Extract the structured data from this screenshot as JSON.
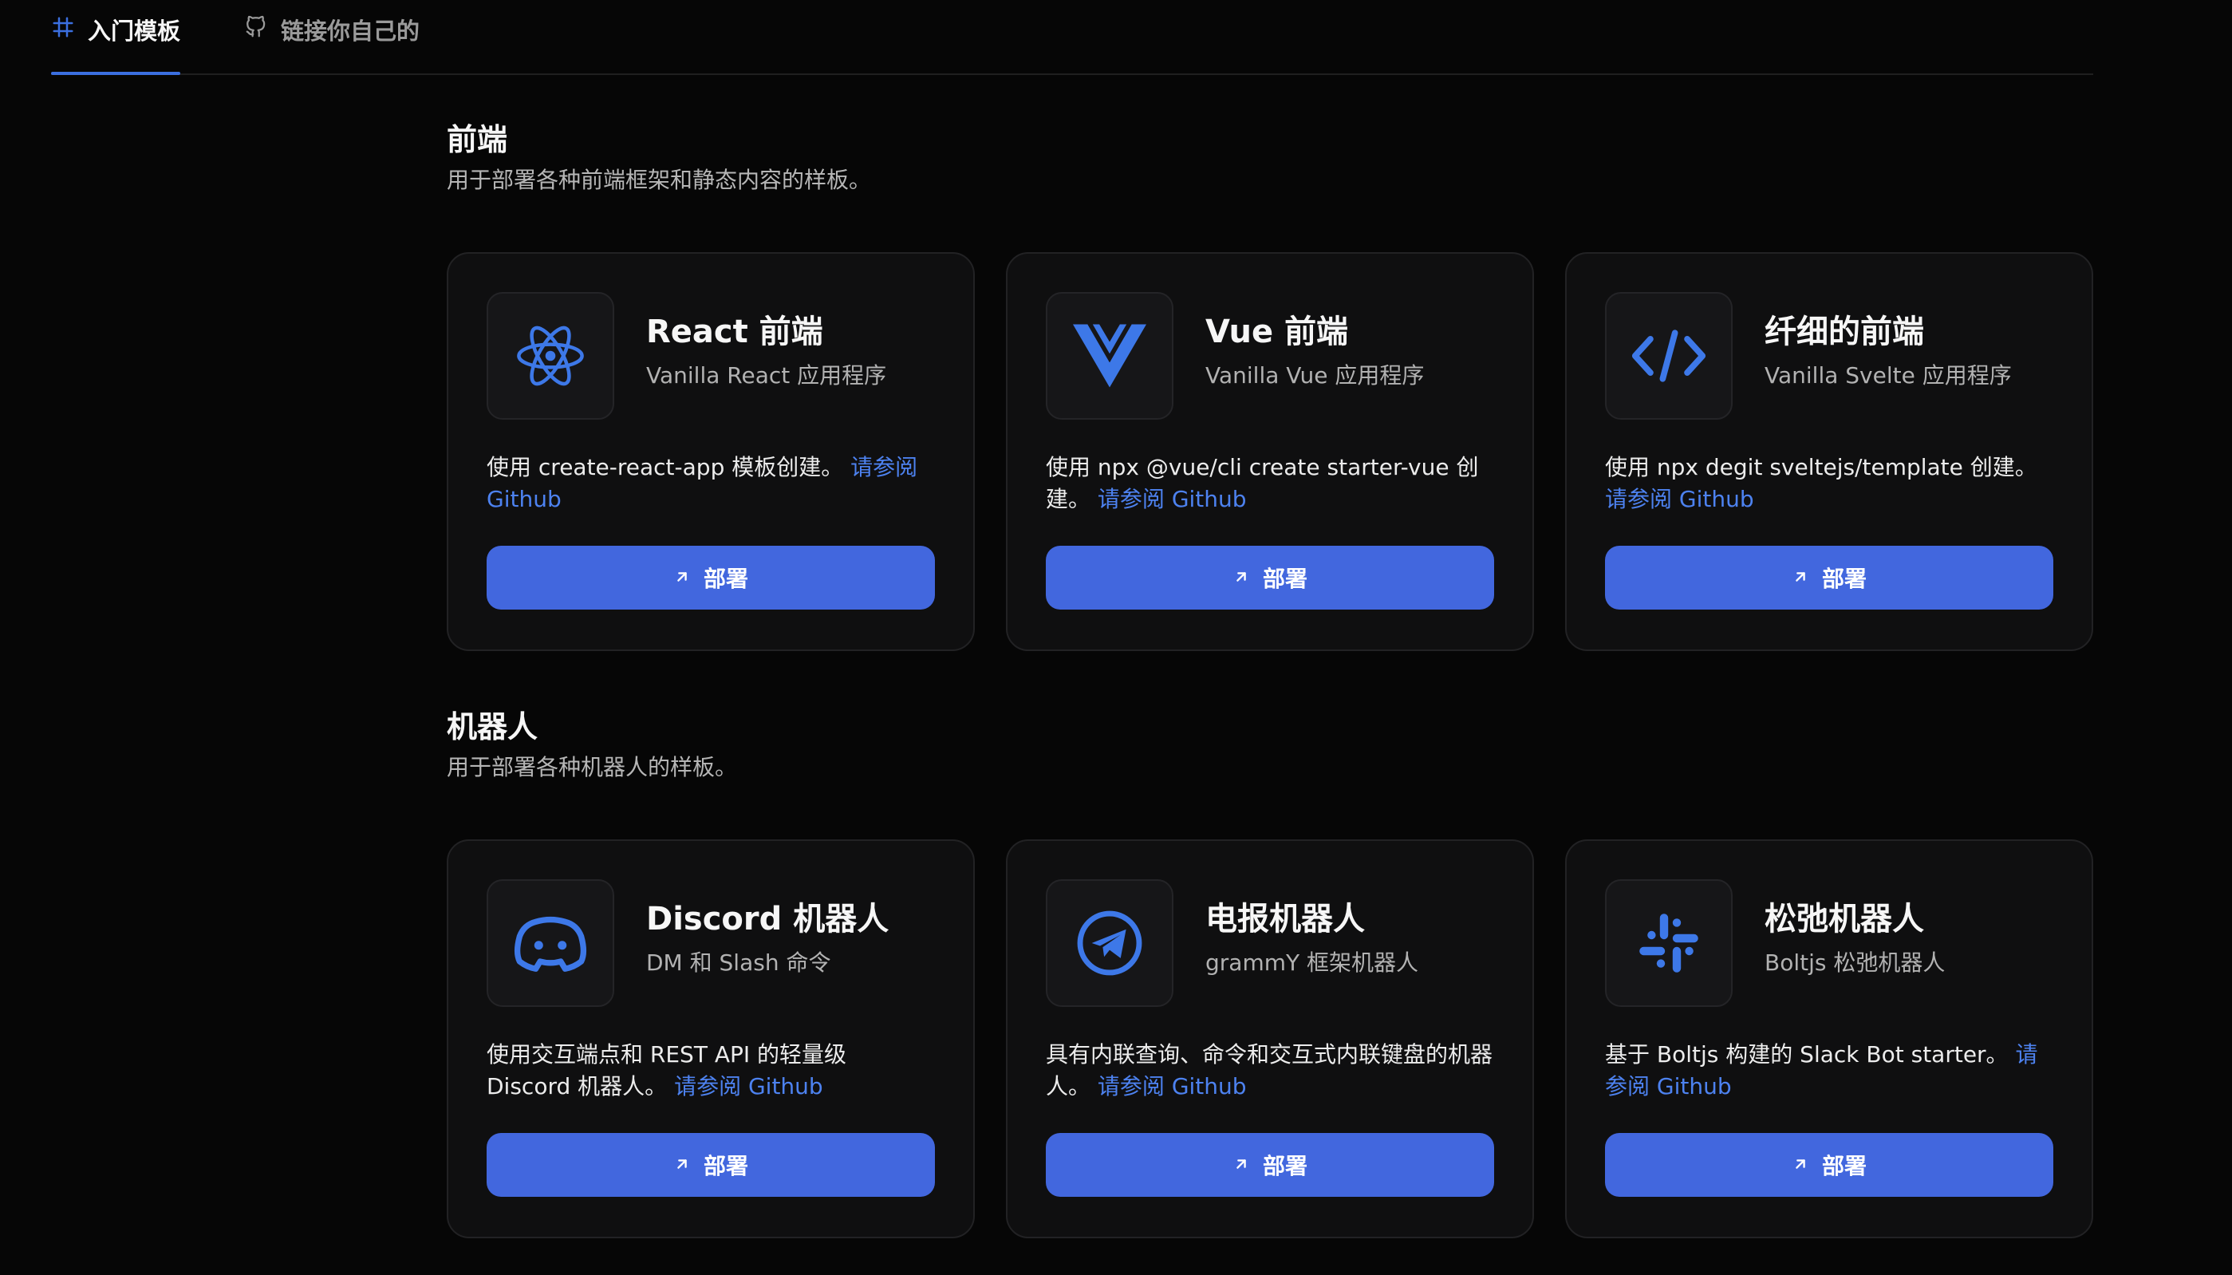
{
  "tabs": [
    {
      "label": "入门模板",
      "icon": "template-icon",
      "active": true
    },
    {
      "label": "链接你自己的",
      "icon": "github-icon",
      "active": false
    }
  ],
  "sections": [
    {
      "title": "前端",
      "description": "用于部署各种前端框架和静态内容的样板。",
      "cards": [
        {
          "title": "React 前端",
          "subtitle": "Vanilla React 应用程序",
          "icon": "react-icon",
          "desc": "使用 create-react-app 模板创建。",
          "link": "请参阅 Github",
          "button": "部署"
        },
        {
          "title": "Vue 前端",
          "subtitle": "Vanilla Vue 应用程序",
          "icon": "vue-icon",
          "desc": "使用 npx @vue/cli create starter-vue 创建。",
          "link": "请参阅 Github",
          "button": "部署"
        },
        {
          "title": "纤细的前端",
          "subtitle": "Vanilla Svelte 应用程序",
          "icon": "code-icon",
          "desc": "使用 npx degit sveltejs/template 创建。",
          "link": "请参阅 Github",
          "button": "部署"
        }
      ]
    },
    {
      "title": "机器人",
      "description": "用于部署各种机器人的样板。",
      "cards": [
        {
          "title": "Discord 机器人",
          "subtitle": "DM 和 Slash 命令",
          "icon": "discord-icon",
          "desc": "使用交互端点和 REST API 的轻量级 Discord 机器人。",
          "link": "请参阅 Github",
          "button": "部署"
        },
        {
          "title": "电报机器人",
          "subtitle": "grammY 框架机器人",
          "icon": "telegram-icon",
          "desc": "具有内联查询、命令和交互式内联键盘的机器人。",
          "link": "请参阅 Github",
          "button": "部署"
        },
        {
          "title": "松弛机器人",
          "subtitle": "Boltjs 松弛机器人",
          "icon": "slack-icon",
          "desc": "基于 Boltjs 构建的 Slack Bot starter。",
          "link": "请参阅 Github",
          "button": "部署"
        }
      ]
    }
  ],
  "colors": {
    "accent": "#4267de",
    "link": "#4d82f0",
    "background": "#060606",
    "card": "#0f0f10"
  }
}
